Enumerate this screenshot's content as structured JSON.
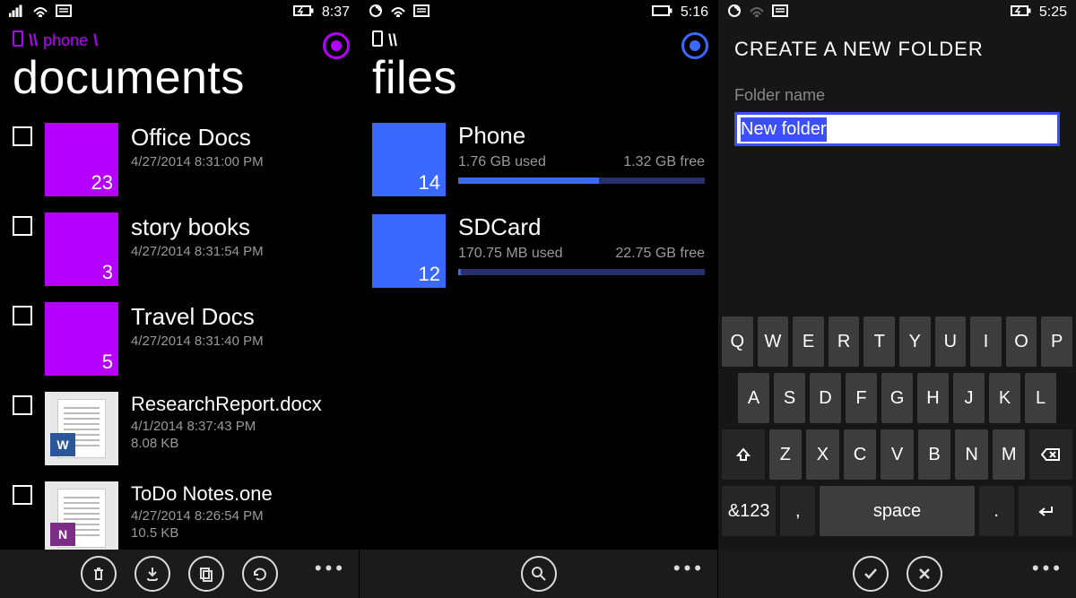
{
  "screen1": {
    "status": {
      "time": "8:37"
    },
    "breadcrumb": {
      "root": "\\\\",
      "label": "phone",
      "tail": "\\"
    },
    "title": "documents",
    "folders": [
      {
        "name": "Office Docs",
        "sub": "4/27/2014 8:31:00 PM",
        "count": "23"
      },
      {
        "name": "story books",
        "sub": "4/27/2014 8:31:54 PM",
        "count": "3"
      },
      {
        "name": "Travel Docs",
        "sub": "4/27/2014 8:31:40 PM",
        "count": "5"
      }
    ],
    "files": [
      {
        "name": "ResearchReport.docx",
        "sub": "4/1/2014 8:37:43 PM",
        "size": "8.08 KB",
        "badge": "W"
      },
      {
        "name": "ToDo Notes.one",
        "sub": "4/27/2014 8:26:54 PM",
        "size": "10.5 KB",
        "badge": "N"
      }
    ]
  },
  "screen2": {
    "status": {
      "time": "5:16"
    },
    "breadcrumb": {
      "root": "\\\\"
    },
    "title": "files",
    "storages": [
      {
        "name": "Phone",
        "count": "14",
        "used": "1.76 GB used",
        "free": "1.32 GB free",
        "pct": 57
      },
      {
        "name": "SDCard",
        "count": "12",
        "used": "170.75 MB used",
        "free": "22.75 GB free",
        "pct": 1
      }
    ]
  },
  "screen3": {
    "status": {
      "time": "5:25"
    },
    "title": "CREATE A NEW FOLDER",
    "field_label": "Folder name",
    "field_value": "New folder",
    "keyboard": {
      "row1": [
        "Q",
        "W",
        "E",
        "R",
        "T",
        "Y",
        "U",
        "I",
        "O",
        "P"
      ],
      "row2": [
        "A",
        "S",
        "D",
        "F",
        "G",
        "H",
        "J",
        "K",
        "L"
      ],
      "row3": [
        "Z",
        "X",
        "C",
        "V",
        "B",
        "N",
        "M"
      ],
      "sym": "&123",
      "comma": ",",
      "space": "space",
      "period": "."
    }
  }
}
